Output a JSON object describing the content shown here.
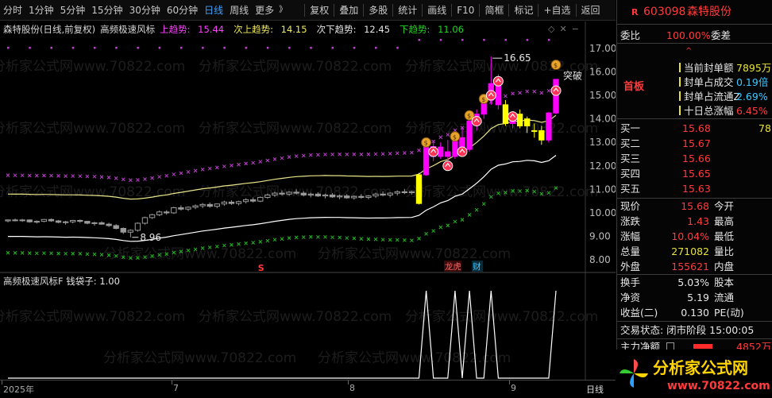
{
  "toolbar": {
    "left": [
      "分时",
      "1分钟",
      "5分钟",
      "15分钟",
      "30分钟",
      "60分钟",
      "日线",
      "周线",
      "更多"
    ],
    "active": "日线",
    "more_caret": "》",
    "right": [
      "复权",
      "叠加",
      "多股",
      "统计",
      "画线",
      "F10",
      "简框",
      "标记",
      "+自选",
      "返回"
    ]
  },
  "main_header": {
    "stock": "森特股份(日线,前复权)",
    "indicator": "高频极速风标",
    "upper_label": "上趋势:",
    "upper_value": "15.44",
    "second_upper_label": "次上趋势:",
    "second_upper_value": "14.15",
    "second_lower_label": "次下趋势:",
    "second_lower_value": "12.45",
    "lower_label": "下趋势:",
    "lower_value": "11.06"
  },
  "sub_header": {
    "indicator": "高频极速风标F",
    "bag_label": "钱袋子:",
    "bag_value": "1.00"
  },
  "annotations": {
    "high": "16.65",
    "low": "8.96",
    "breakout": "突破",
    "marker_s": "S",
    "marker_lhb": "龙虎",
    "marker_cai": "财"
  },
  "watermark": "分析家公式网www.70822.com",
  "price_axis": [
    "17.00",
    "16.00",
    "15.00",
    "14.00",
    "13.00",
    "12.00",
    "11.00",
    "10.00",
    "9.00",
    "8.00"
  ],
  "date_axis": [
    {
      "label": "2025年",
      "x": "2025-06"
    },
    {
      "label": "7",
      "x": "2025-07"
    },
    {
      "label": "8",
      "x": "2025-08"
    },
    {
      "label": "9",
      "x": "2025-09"
    }
  ],
  "period_label": "日线",
  "panel": {
    "code": "603098",
    "name": "森特股份",
    "r_icon": "R",
    "weibi_label": "委比",
    "weibi_value": "100.00%",
    "weicha_label": "委差",
    "caret_up": "^",
    "board_tag": "首板",
    "seal": [
      {
        "label": "当前封单额",
        "value": "7895万",
        "color": "#e8e23a"
      },
      {
        "label": "封单占成交",
        "value": "0.19倍",
        "color": "#3ec8ff"
      },
      {
        "label": "封单占流通Z",
        "value": "2.69%",
        "color": "#3ec8ff"
      },
      {
        "label": "十日总涨幅",
        "value": "6.45%",
        "color": "#ff3b3b"
      }
    ],
    "bids": [
      {
        "label": "买一",
        "price": "15.68",
        "vol": "78"
      },
      {
        "label": "买二",
        "price": "15.67",
        "vol": ""
      },
      {
        "label": "买三",
        "price": "15.66",
        "vol": ""
      },
      {
        "label": "买四",
        "price": "15.65",
        "vol": ""
      },
      {
        "label": "买五",
        "price": "15.63",
        "vol": ""
      }
    ],
    "stats": [
      {
        "l1": "现价",
        "v1": "15.68",
        "l2": "今开",
        "c1": "#ff3b3b"
      },
      {
        "l1": "涨跌",
        "v1": "1.43",
        "l2": "最高",
        "c1": "#ff3b3b"
      },
      {
        "l1": "涨幅",
        "v1": "10.04%",
        "l2": "最低",
        "c1": "#ff3b3b"
      },
      {
        "l1": "总量",
        "v1": "271082",
        "l2": "量比",
        "c1": "#e8e23a"
      },
      {
        "l1": "外盘",
        "v1": "155621",
        "l2": "内盘",
        "c1": "#ff3b3b"
      }
    ],
    "stats2": [
      {
        "l1": "换手",
        "v1": "5.03%",
        "l2": "股本"
      },
      {
        "l1": "净资",
        "v1": "5.19",
        "l2": "流通"
      },
      {
        "l1": "收益(二)",
        "v1": "0.130",
        "l2": "PE(动)"
      }
    ],
    "trade_state": "交易状态: 闭市阶段 15:00:05",
    "net_label": "主力净额",
    "net_value": "4852万"
  },
  "brand": {
    "name": "分析家公式网",
    "url": "www.70822.com"
  },
  "colors": {
    "up": "#ff3b3b",
    "down": "#21d321",
    "yellow_bar": "#ffff00",
    "magenta": "#ff00ff",
    "purple_x": "#c040d0",
    "green_x": "#22bb22",
    "grey_bar": "#9a9a9a",
    "line_white": "#ffffff",
    "line_yellow": "#e8e48a"
  },
  "chart_data": {
    "type": "candlestick",
    "title": "",
    "ylim": [
      7.6,
      17.4
    ],
    "grid": false,
    "candles": [
      [
        9.66,
        9.72,
        9.6,
        9.7
      ],
      [
        9.7,
        9.76,
        9.64,
        9.68
      ],
      [
        9.68,
        9.74,
        9.62,
        9.7
      ],
      [
        9.7,
        9.72,
        9.58,
        9.62
      ],
      [
        9.62,
        9.68,
        9.55,
        9.64
      ],
      [
        9.64,
        9.74,
        9.6,
        9.72
      ],
      [
        9.72,
        9.76,
        9.62,
        9.66
      ],
      [
        9.66,
        9.7,
        9.56,
        9.6
      ],
      [
        9.6,
        9.66,
        9.5,
        9.62
      ],
      [
        9.62,
        9.7,
        9.56,
        9.68
      ],
      [
        9.68,
        9.72,
        9.58,
        9.64
      ],
      [
        9.64,
        9.66,
        9.52,
        9.56
      ],
      [
        9.56,
        9.62,
        9.46,
        9.58
      ],
      [
        9.58,
        9.64,
        9.5,
        9.52
      ],
      [
        9.52,
        9.58,
        9.4,
        9.46
      ],
      [
        9.46,
        9.52,
        9.3,
        9.34
      ],
      [
        9.34,
        9.38,
        9.1,
        9.18
      ],
      [
        9.18,
        9.3,
        8.96,
        9.26
      ],
      [
        9.26,
        9.6,
        9.2,
        9.56
      ],
      [
        9.56,
        9.84,
        9.5,
        9.8
      ],
      [
        9.8,
        9.96,
        9.74,
        9.92
      ],
      [
        9.92,
        10.1,
        9.86,
        10.04
      ],
      [
        10.04,
        10.12,
        9.92,
        10.0
      ],
      [
        10.0,
        10.26,
        9.96,
        10.22
      ],
      [
        10.22,
        10.32,
        10.1,
        10.16
      ],
      [
        10.16,
        10.28,
        10.08,
        10.24
      ],
      [
        10.24,
        10.36,
        10.16,
        10.3
      ],
      [
        10.3,
        10.42,
        10.2,
        10.36
      ],
      [
        10.36,
        10.44,
        10.22,
        10.28
      ],
      [
        10.28,
        10.4,
        10.2,
        10.38
      ],
      [
        10.38,
        10.52,
        10.3,
        10.46
      ],
      [
        10.46,
        10.54,
        10.34,
        10.4
      ],
      [
        10.4,
        10.52,
        10.32,
        10.48
      ],
      [
        10.48,
        10.62,
        10.4,
        10.56
      ],
      [
        10.56,
        10.66,
        10.44,
        10.5
      ],
      [
        10.5,
        10.7,
        10.46,
        10.66
      ],
      [
        10.66,
        10.82,
        10.6,
        10.76
      ],
      [
        10.76,
        10.9,
        10.68,
        10.84
      ],
      [
        10.84,
        10.96,
        10.74,
        10.8
      ],
      [
        10.8,
        10.92,
        10.72,
        10.88
      ],
      [
        10.88,
        11.0,
        10.78,
        10.84
      ],
      [
        10.84,
        10.92,
        10.7,
        10.76
      ],
      [
        10.76,
        10.86,
        10.66,
        10.8
      ],
      [
        10.8,
        10.88,
        10.68,
        10.72
      ],
      [
        10.72,
        10.82,
        10.62,
        10.76
      ],
      [
        10.76,
        10.84,
        10.64,
        10.68
      ],
      [
        10.68,
        10.78,
        10.58,
        10.72
      ],
      [
        10.72,
        10.8,
        10.6,
        10.64
      ],
      [
        10.64,
        10.74,
        10.56,
        10.7
      ],
      [
        10.7,
        10.8,
        10.6,
        10.66
      ],
      [
        10.66,
        10.76,
        10.58,
        10.72
      ],
      [
        10.72,
        10.86,
        10.64,
        10.8
      ],
      [
        10.8,
        10.92,
        10.7,
        10.76
      ],
      [
        10.76,
        10.88,
        10.66,
        10.84
      ],
      [
        10.84,
        10.96,
        10.74,
        10.9
      ],
      [
        10.9,
        11.02,
        10.8,
        10.86
      ],
      [
        10.86,
        10.94,
        10.78,
        10.9
      ],
      [
        10.4,
        11.7,
        10.36,
        11.62
      ],
      [
        11.62,
        12.9,
        11.58,
        12.82
      ],
      [
        12.82,
        13.0,
        12.2,
        12.4
      ],
      [
        12.4,
        13.0,
        12.3,
        12.8
      ],
      [
        12.6,
        13.1,
        12.2,
        12.4
      ],
      [
        12.4,
        13.4,
        12.3,
        13.2
      ],
      [
        13.2,
        13.6,
        12.6,
        12.7
      ],
      [
        12.7,
        14.0,
        12.6,
        13.9
      ],
      [
        13.9,
        14.4,
        13.5,
        14.2
      ],
      [
        14.2,
        15.0,
        14.0,
        14.8
      ],
      [
        14.8,
        16.65,
        14.6,
        15.5
      ],
      [
        15.5,
        15.9,
        14.4,
        14.6
      ],
      [
        14.6,
        14.8,
        13.7,
        13.8
      ],
      [
        13.8,
        14.3,
        13.6,
        14.2
      ],
      [
        14.2,
        14.4,
        13.6,
        13.7
      ],
      [
        13.7,
        14.1,
        13.4,
        14.0
      ],
      [
        13.5,
        13.8,
        13.2,
        13.5
      ],
      [
        13.5,
        13.7,
        12.9,
        13.1
      ],
      [
        13.1,
        14.3,
        13.0,
        14.25
      ],
      [
        14.25,
        15.68,
        14.2,
        15.68
      ]
    ],
    "series": [
      {
        "name": "上趋势",
        "values_last": 15.44
      },
      {
        "name": "次上趋势",
        "values_last": 14.15
      },
      {
        "name": "次下趋势",
        "values_last": 12.45
      },
      {
        "name": "下趋势",
        "values_last": 11.06
      }
    ],
    "sub_series_values": [
      0,
      0,
      0,
      0,
      0,
      0,
      0,
      0,
      0,
      0,
      0,
      0,
      0,
      0,
      0,
      0,
      0,
      0,
      0,
      0,
      0,
      0,
      0,
      0,
      0,
      0,
      0,
      0,
      0,
      0,
      0,
      0,
      0,
      0,
      0,
      0,
      0,
      0,
      0,
      0,
      0,
      0,
      0,
      0,
      0,
      0,
      0,
      0,
      0,
      0,
      0,
      0,
      0,
      0,
      0,
      0,
      0,
      0,
      1,
      0,
      0,
      0,
      1,
      0,
      1,
      0,
      0,
      1,
      0,
      0,
      0,
      0,
      0,
      0,
      0,
      0,
      1
    ]
  }
}
